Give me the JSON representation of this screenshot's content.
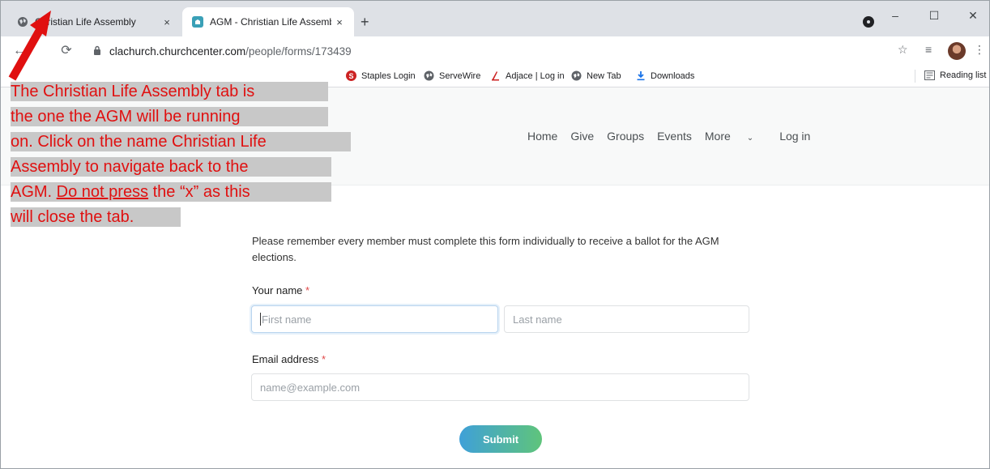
{
  "tabs": [
    {
      "title": "Christian Life Assembly",
      "close": "×",
      "state": "inactive"
    },
    {
      "title": "AGM - Christian Life Assembly",
      "close": "×",
      "state": "active"
    }
  ],
  "new_tab": "+",
  "window_controls": {
    "minimize": "–",
    "maximize": "☐",
    "close": "✕"
  },
  "address_bar": {
    "domain": "clachurch.churchcenter.com",
    "path": "/people/forms/173439"
  },
  "bookmarks": [
    {
      "label": "Staples Login"
    },
    {
      "label": "ServeWire"
    },
    {
      "label": "Adjace | Log in"
    },
    {
      "label": "New Tab"
    },
    {
      "label": "Downloads"
    }
  ],
  "reading_list": "Reading list",
  "site_nav": [
    "Home",
    "Give",
    "Groups",
    "Events",
    "More",
    "Log in"
  ],
  "form": {
    "intro": "Please remember every member must complete this form individually to receive a ballot for the AGM elections.",
    "name_label": "Your name",
    "required_mark": "*",
    "first_name_placeholder": "First name",
    "last_name_placeholder": "Last name",
    "email_label": "Email address",
    "email_placeholder": "name@example.com",
    "submit": "Submit"
  },
  "annotation": {
    "lines": [
      "The Christian Life Assembly tab is",
      "the one the AGM will be running",
      "on. Click on the name Christian Life",
      "Assembly to navigate back to the"
    ],
    "line5_start": "AGM. ",
    "line5_underlined": "Do not press",
    "line5_end": " the “x” as this",
    "line6": "will close the tab."
  },
  "colors": {
    "annotation_text": "#e01010",
    "submit_gradient_start": "#3fa0d8",
    "submit_gradient_end": "#5fc47b",
    "required": "#e04848"
  }
}
